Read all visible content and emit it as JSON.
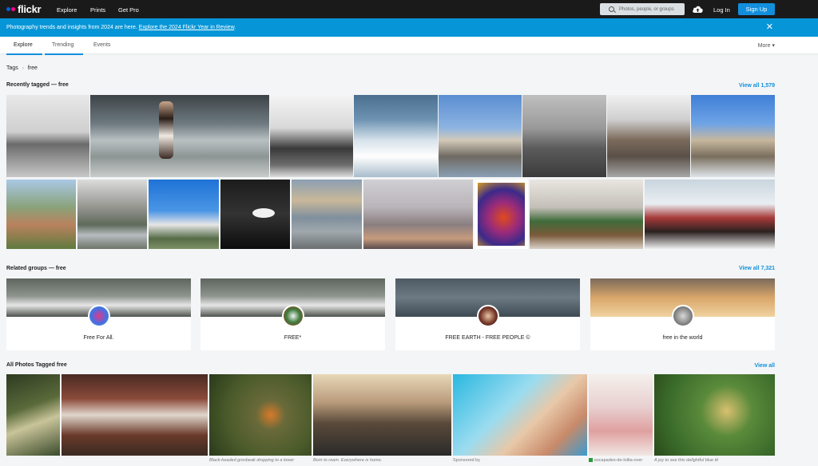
{
  "topbar": {
    "logo": "flickr",
    "logo_colors": [
      "#0063dc",
      "#ff0084"
    ],
    "nav": [
      "Explore",
      "Prints",
      "Get Pro"
    ],
    "search_placeholder": "Photos, people, or groups",
    "login": "Log In",
    "signup": "Sign Up"
  },
  "banner": {
    "text": "Photography trends and insights from 2024 are here. ",
    "link": "Explore the 2024 Flickr Year in Review",
    "suffix": ".",
    "close": "✕"
  },
  "tabs": [
    "Explore",
    "Trending",
    "Events"
  ],
  "more": "More ▾",
  "breadcrumb": {
    "root": "Tags",
    "sep": "›",
    "current": "free"
  },
  "recent": {
    "title": "Recently tagged — free",
    "view_all": "View all 1,579"
  },
  "groups": {
    "title": "Related groups — free",
    "view_all": "View all 7,321",
    "items": [
      {
        "name": "Free For All."
      },
      {
        "name": "FREE*"
      },
      {
        "name": "FREE EARTH - FREE PEOPLE ©"
      },
      {
        "name": "free in the world"
      }
    ]
  },
  "all_photos": {
    "title": "All Photos Tagged free",
    "view_all": "View all",
    "captions": [
      "Black-headed grosbeak dropping to a lower",
      "Born to roam. Everywhere is home.",
      "Sponsored by",
      "escapades-de-lolita-over",
      "A joy to see this delightful blue tit"
    ]
  },
  "colors": {
    "accent": "#128fdc",
    "banner": "#0696d7",
    "topbar": "#1a1a1b"
  }
}
